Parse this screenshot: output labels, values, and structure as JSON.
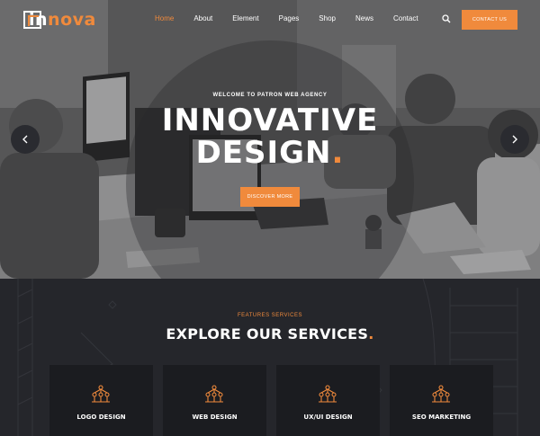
{
  "brand": {
    "logo_text_a": "in",
    "logo_text_b": "nova",
    "accent_color": "#f08a3c"
  },
  "nav": {
    "items": [
      {
        "label": "Home",
        "active": true
      },
      {
        "label": "About",
        "active": false
      },
      {
        "label": "Element",
        "active": false
      },
      {
        "label": "Pages",
        "active": false
      },
      {
        "label": "Shop",
        "active": false
      },
      {
        "label": "News",
        "active": false
      },
      {
        "label": "Contact",
        "active": false
      }
    ],
    "contact_label": "CONTACT US",
    "search_icon": "search-icon"
  },
  "hero": {
    "subtitle": "WELCOME TO PATRON WEB AGENCY",
    "title_line1": "INNOVATIVE",
    "title_line2": "DESIGN",
    "title_dot": ".",
    "cta_label": "DISCOVER MORE",
    "prev_icon": "chevron-left-icon",
    "next_icon": "chevron-right-icon"
  },
  "services": {
    "eyebrow": "FEATURES SERVICES",
    "title": "EXPLORE OUR SERVICES",
    "title_dot": ".",
    "cards": [
      {
        "label": "LOGO DESIGN",
        "icon": "network-icon"
      },
      {
        "label": "WEB DESIGN",
        "icon": "network-icon"
      },
      {
        "label": "UX/UI DESIGN",
        "icon": "network-icon"
      },
      {
        "label": "SEO MARKETING",
        "icon": "network-icon"
      }
    ]
  }
}
